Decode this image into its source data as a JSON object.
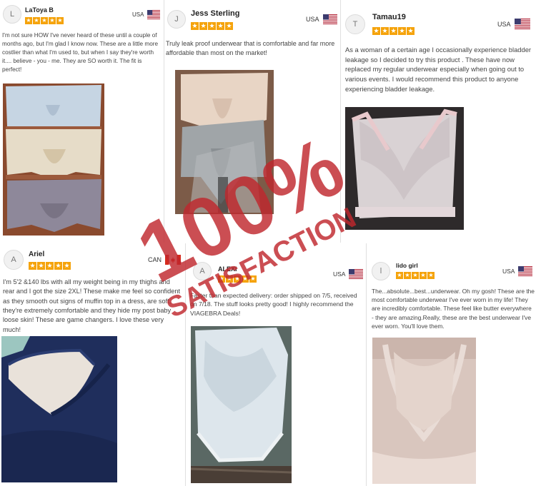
{
  "reviews": [
    {
      "initial": "L",
      "name": "LaToya B",
      "country": "USA",
      "flag": "us",
      "stars": 5,
      "text": "I'm not sure HOW I've never heard of these until a couple of months ago, but I'm glad I know now. These are a little more costlier than what I'm used to, but when I say they're worth it.... believe - you - me. They are SO worth it. The fit is perfect!"
    },
    {
      "initial": "J",
      "name": "Jess Sterling",
      "country": "USA",
      "flag": "us",
      "stars": 5,
      "text": "Truly leak proof underwear that is comfortable and far more affordable than most on the market!"
    },
    {
      "initial": "T",
      "name": "Tamau19",
      "country": "USA",
      "flag": "us",
      "stars": 5,
      "text": "As a woman of a certain age I occasionally experience bladder leakage so I decided to try this product . These have now replaced my regular underwear especially when going out to various events. I would recommend this product to anyone experiencing bladder leakage."
    },
    {
      "initial": "A",
      "name": "Ariel",
      "country": "CAN",
      "flag": "ca",
      "stars": 5,
      "text": "I'm 5'2 &140 lbs with all my weight being in my thighs and rear and I got the size 2XL! These make me feel so confident as they smooth out signs of muffin top in a dress, are soft, they're extremely comfortable and they hide my post baby loose skin! These are game changers. I love these very much!"
    },
    {
      "initial": "A",
      "name": "ALEXI",
      "country": "USA",
      "flag": "us",
      "stars": 5,
      "text": "Faster than expected delivery: order shipped on 7/5, received on 7/18. The stuff looks pretty good! I highly recommend the VIAGEBRA Deals!"
    },
    {
      "initial": "l",
      "name": "lido girl",
      "country": "USA",
      "flag": "us",
      "stars": 5,
      "text": "The...absolute...best...underwear. Oh my gosh! These are the most comfortable underwear I've ever worn in my life! They are incredibly comfortable. These feel like butter everywhere - they are amazing.Really, these are the best underwear I've ever worn. You'll love them."
    }
  ],
  "watermark": {
    "big": "100%",
    "sub": "SATISFACTION",
    "color": "#c0272d"
  },
  "colors": {
    "star": "#f5a30b",
    "border": "#e0e0e0"
  }
}
